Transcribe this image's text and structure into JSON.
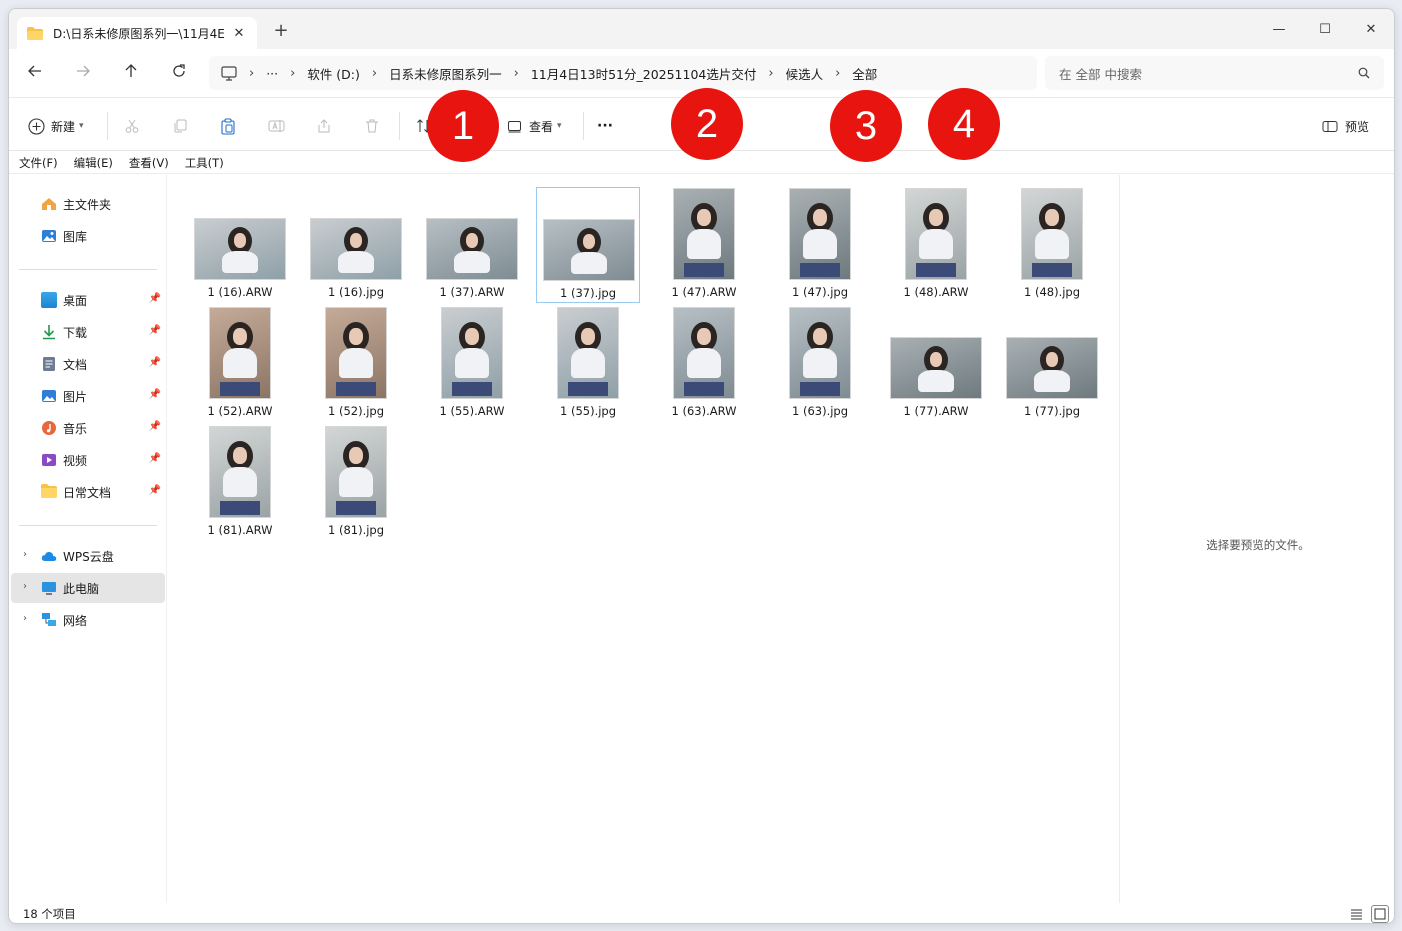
{
  "window": {
    "tab_title": "D:\\日系未修原图系列一\\11月4E",
    "tab_close": "✕",
    "new_tab": "+",
    "minimize": "—",
    "maximize": "☐",
    "close": "✕"
  },
  "nav": {
    "ellipsis": "···",
    "breadcrumbs": [
      "软件 (D:)",
      "日系未修原图系列一",
      "11月4日13时51分_20251104选片交付",
      "候选人",
      "全部"
    ],
    "search_placeholder": "在 全部 中搜索"
  },
  "commands": {
    "new_label": "新建",
    "view_label": "查看",
    "more_label": "···",
    "preview_label": "预览"
  },
  "menu": [
    "文件(F)",
    "编辑(E)",
    "查看(V)",
    "工具(T)"
  ],
  "sidebar": {
    "quick": [
      {
        "label": "主文件夹",
        "icon": "home-icon"
      },
      {
        "label": "图库",
        "icon": "gallery-icon"
      }
    ],
    "pinned": [
      {
        "label": "桌面",
        "icon": "desktop-icon"
      },
      {
        "label": "下载",
        "icon": "download-icon"
      },
      {
        "label": "文档",
        "icon": "document-icon"
      },
      {
        "label": "图片",
        "icon": "pictures-icon"
      },
      {
        "label": "音乐",
        "icon": "music-icon"
      },
      {
        "label": "视频",
        "icon": "video-icon"
      },
      {
        "label": "日常文档",
        "icon": "folder-icon"
      }
    ],
    "locations": [
      {
        "label": "WPS云盘",
        "icon": "cloud-icon"
      },
      {
        "label": "此电脑",
        "icon": "computer-icon",
        "selected": true
      },
      {
        "label": "网络",
        "icon": "network-icon"
      }
    ]
  },
  "files": [
    {
      "name": "1 (16).ARW",
      "orientation": "landscape"
    },
    {
      "name": "1 (16).jpg",
      "orientation": "landscape"
    },
    {
      "name": "1 (37).ARW",
      "orientation": "landscape"
    },
    {
      "name": "1 (37).jpg",
      "orientation": "landscape",
      "selected": true
    },
    {
      "name": "1 (47).ARW",
      "orientation": "portrait"
    },
    {
      "name": "1 (47).jpg",
      "orientation": "portrait"
    },
    {
      "name": "1 (48).ARW",
      "orientation": "portrait"
    },
    {
      "name": "1 (48).jpg",
      "orientation": "portrait"
    },
    {
      "name": "1 (52).ARW",
      "orientation": "portrait"
    },
    {
      "name": "1 (52).jpg",
      "orientation": "portrait"
    },
    {
      "name": "1 (55).ARW",
      "orientation": "portrait"
    },
    {
      "name": "1 (55).jpg",
      "orientation": "portrait"
    },
    {
      "name": "1 (63).ARW",
      "orientation": "portrait"
    },
    {
      "name": "1 (63).jpg",
      "orientation": "portrait"
    },
    {
      "name": "1 (77).ARW",
      "orientation": "landscape"
    },
    {
      "name": "1 (77).jpg",
      "orientation": "landscape"
    },
    {
      "name": "1 (81).ARW",
      "orientation": "portrait"
    },
    {
      "name": "1 (81).jpg",
      "orientation": "portrait"
    }
  ],
  "preview_message": "选择要预览的文件。",
  "status": {
    "item_count": "18 个项目"
  },
  "annotations": [
    "1",
    "2",
    "3",
    "4"
  ],
  "colors": {
    "badge": "#e8140f",
    "selection": "#9ccbf0",
    "folder": "#f5c24b"
  }
}
